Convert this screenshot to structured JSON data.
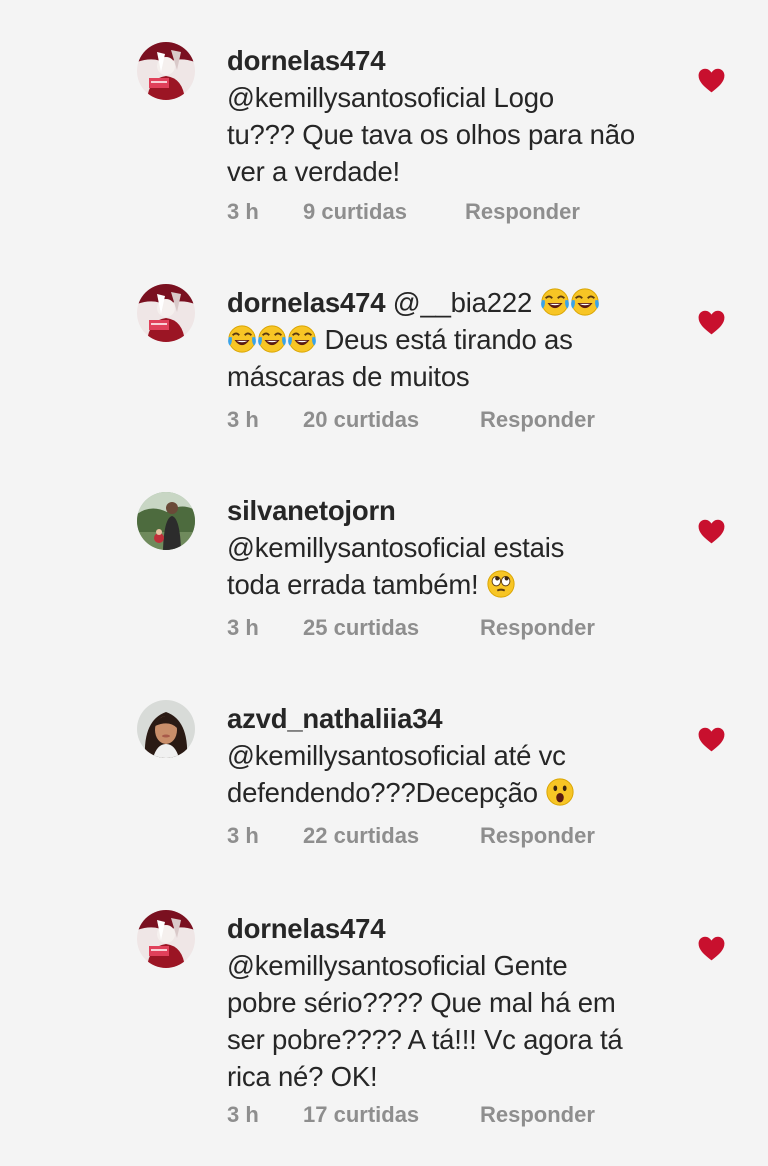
{
  "comments": [
    {
      "username": "dornelas474",
      "mention": "@kemillysantosoficial",
      "line1": "Logo",
      "line2": "tu??? Que tava os olhos para não",
      "line3": "ver a verdade!",
      "time": "3 h",
      "likes": "9 curtidas",
      "reply": "Responder",
      "avatar_icon": "profile-avatar-red"
    },
    {
      "username": "dornelas474",
      "mention": "@__bia222",
      "line2": "Deus está tirando as",
      "line3": "máscaras de muitos",
      "emojis": [
        "face-with-tears-of-joy",
        "face-with-tears-of-joy",
        "face-with-tears-of-joy",
        "face-with-tears-of-joy",
        "face-with-tears-of-joy"
      ],
      "time": "3 h",
      "likes": "20 curtidas",
      "reply": "Responder",
      "avatar_icon": "profile-avatar-red"
    },
    {
      "username": "silvanetojorn",
      "mention": "@kemillysantosoficial",
      "line1": "estais",
      "line2": "toda errada também!",
      "emojis": [
        "face-with-rolling-eyes"
      ],
      "time": "3 h",
      "likes": "25 curtidas",
      "reply": "Responder",
      "avatar_icon": "profile-avatar-outdoor"
    },
    {
      "username": "azvd_nathaliia34",
      "mention": "@kemillysantosoficial",
      "line1": "até vc",
      "line2": "defendendo???Decepção",
      "emojis": [
        "face-with-open-mouth"
      ],
      "time": "3 h",
      "likes": "22 curtidas",
      "reply": "Responder",
      "avatar_icon": "profile-avatar-woman"
    },
    {
      "username": "dornelas474",
      "mention": "@kemillysantosoficial",
      "line1": "Gente",
      "line2": "pobre sério???? Que mal há em",
      "line3": "ser pobre???? A tá!!! Vc agora tá",
      "line4": "rica né? OK!",
      "time": "3 h",
      "likes": "17 curtidas",
      "reply": "Responder",
      "avatar_icon": "profile-avatar-red"
    }
  ],
  "colors": {
    "background": "#f4f4f4",
    "text": "#262626",
    "meta": "#8e8e8e",
    "heart": "#c8102e"
  },
  "heart_icon": "heart-liked-icon"
}
